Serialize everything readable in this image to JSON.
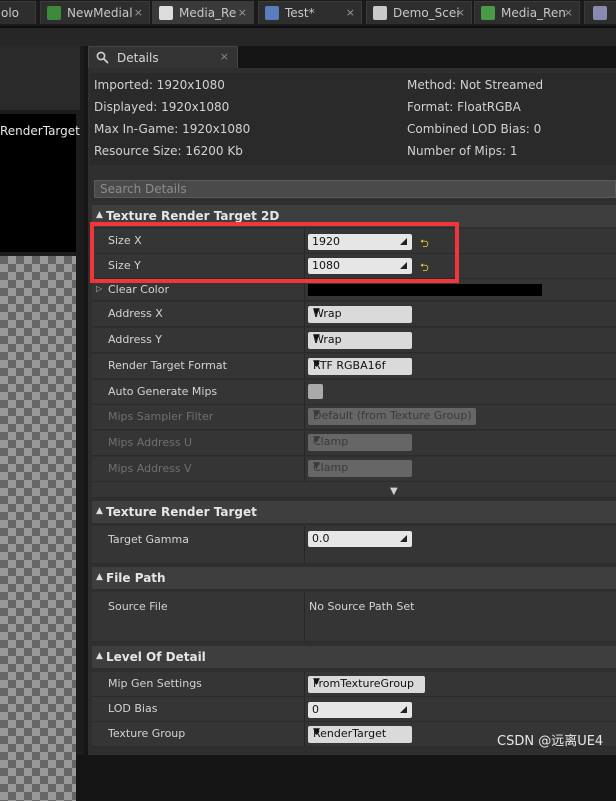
{
  "tabs": [
    {
      "label": "olo",
      "icon": "none"
    },
    {
      "label": "NewMedial",
      "icon": "media-icon",
      "close": "×"
    },
    {
      "label": "Media_Re",
      "icon": "texture-icon",
      "close": "×"
    },
    {
      "label": "Test*",
      "icon": "blueprint-icon",
      "close": "×"
    },
    {
      "label": "Demo_Scei",
      "icon": "level-icon",
      "close": "×"
    },
    {
      "label": "Media_Ren",
      "icon": "material-icon",
      "close": "×"
    }
  ],
  "left_panel": {
    "label": "RenderTarget"
  },
  "details": {
    "title": "Details",
    "close": "×"
  },
  "info": {
    "imported": "Imported: 1920x1080",
    "displayed": "Displayed: 1920x1080",
    "max_in_game": "Max In-Game: 1920x1080",
    "resource_size": "Resource Size: 16200 Kb",
    "method": "Method: Not Streamed",
    "format": "Format: FloatRGBA",
    "combined_lod": "Combined LOD Bias: 0",
    "num_mips": "Number of Mips: 1"
  },
  "search": {
    "placeholder": "Search Details"
  },
  "categories": {
    "trt2d": "Texture Render Target 2D",
    "trt": "Texture Render Target",
    "file_path": "File Path",
    "lod": "Level Of Detail"
  },
  "props": {
    "size_x": {
      "label": "Size X",
      "value": "1920"
    },
    "size_y": {
      "label": "Size Y",
      "value": "1080"
    },
    "clear_color": {
      "label": "Clear Color"
    },
    "address_x": {
      "label": "Address X",
      "value": "Wrap"
    },
    "address_y": {
      "label": "Address Y",
      "value": "Wrap"
    },
    "rt_format": {
      "label": "Render Target Format",
      "value": "RTF RGBA16f"
    },
    "auto_mips": {
      "label": "Auto Generate Mips"
    },
    "mips_filter": {
      "label": "Mips Sampler Filter",
      "value": "Default (from Texture Group)"
    },
    "mips_addr_u": {
      "label": "Mips Address U",
      "value": "Clamp"
    },
    "mips_addr_v": {
      "label": "Mips Address V",
      "value": "Clamp"
    },
    "target_gamma": {
      "label": "Target Gamma",
      "value": "0.0"
    },
    "source_file": {
      "label": "Source File",
      "value": "No Source Path Set"
    },
    "mip_gen": {
      "label": "Mip Gen Settings",
      "value": "FromTextureGroup"
    },
    "lod_bias": {
      "label": "LOD Bias",
      "value": "0"
    },
    "texture_group": {
      "label": "Texture Group",
      "value": "RenderTarget"
    }
  },
  "watermark": "CSDN @远离UE4",
  "colors": {
    "highlight": "#f2343b",
    "reset": "#e8d23a"
  }
}
